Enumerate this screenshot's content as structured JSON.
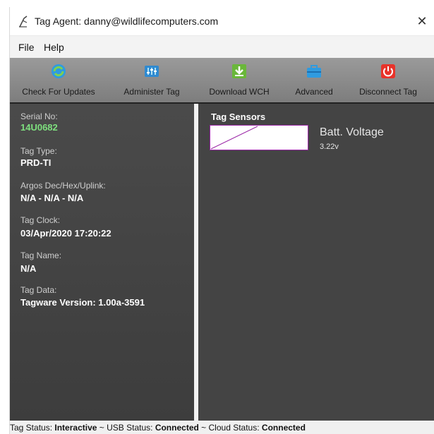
{
  "window": {
    "title": "Tag Agent: danny@wildlifecomputers.com",
    "close_glyph": "✕"
  },
  "menu": {
    "file": "File",
    "help": "Help"
  },
  "toolbar": {
    "check_updates": "Check For Updates",
    "administer_tag": "Administer Tag",
    "download_wch": "Download WCH",
    "advanced": "Advanced",
    "disconnect_tag": "Disconnect Tag"
  },
  "tag_info": {
    "serial_label": "Serial No:",
    "serial_value": "14U0682",
    "type_label": "Tag Type:",
    "type_value": "PRD-TI",
    "argos_label": "Argos Dec/Hex/Uplink:",
    "argos_value": "N/A - N/A - N/A",
    "clock_label": "Tag Clock:",
    "clock_value": "03/Apr/2020 17:20:22",
    "name_label": "Tag Name:",
    "name_value": "N/A",
    "data_label": "Tag Data:",
    "data_value": "Tagware Version: 1.00a-3591"
  },
  "sensors": {
    "title": "Tag Sensors",
    "items": [
      {
        "name": "Batt. Voltage",
        "value": "3.22v"
      }
    ]
  },
  "status": {
    "tag_label": "Tag Status:",
    "tag_value": "Interactive",
    "usb_label": "~ USB Status:",
    "usb_value": "Connected",
    "cloud_label": "~ Cloud Status:",
    "cloud_value": "Connected"
  },
  "colors": {
    "serial": "#7ee07e",
    "sensor_line": "#9c2aa8",
    "disconnect": "#e8332a"
  }
}
